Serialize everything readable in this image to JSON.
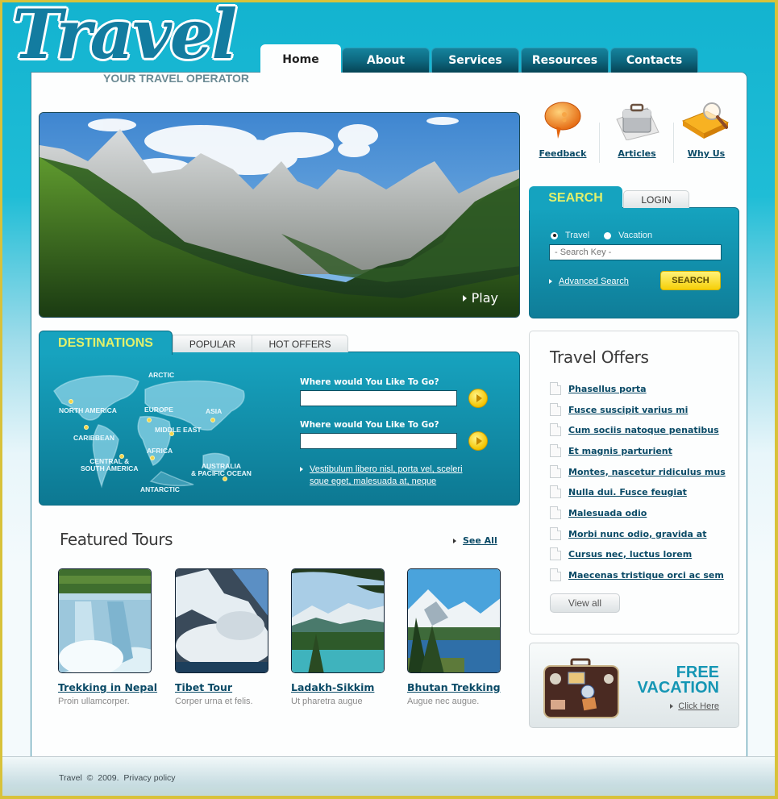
{
  "brand": {
    "logo_text": "Travel",
    "tagline": "YOUR TRAVEL OPERATOR"
  },
  "nav": {
    "items": [
      {
        "label": "Home",
        "active": true
      },
      {
        "label": "About"
      },
      {
        "label": "Services"
      },
      {
        "label": "Resources"
      },
      {
        "label": "Contacts"
      }
    ]
  },
  "hero": {
    "play_label": "Play",
    "icon": "play-triangle-icon"
  },
  "quick_links": [
    {
      "label": "Feedback",
      "icon": "speech-bubble-icon"
    },
    {
      "label": "Articles",
      "icon": "briefcase-icon"
    },
    {
      "label": "Why Us",
      "icon": "book-magnifier-icon"
    }
  ],
  "search": {
    "tabs": [
      "SEARCH",
      "LOGIN"
    ],
    "radios": [
      {
        "label": "Travel",
        "checked": true
      },
      {
        "label": "Vacation",
        "checked": false
      }
    ],
    "input_placeholder": "- Search Key -",
    "advanced_link": "Advanced Search",
    "button_label": "SEARCH"
  },
  "destinations": {
    "tabs": [
      "DESTINATIONS",
      "POPULAR",
      "HOT OFFERS"
    ],
    "map_labels": {
      "arctic": "ARCTIC",
      "north_america": "NORTH AMERICA",
      "europe": "EUROPE",
      "asia": "ASIA",
      "middle_east": "MIDDLE EAST",
      "caribbean": "CARIBBEAN",
      "africa": "AFRICA",
      "central_south_america_1": "CENTRAL &",
      "central_south_america_2": "SOUTH AMERICA",
      "australia_1": "AUSTRALIA",
      "australia_2": "& PACIFIC OCEAN",
      "antarctic": "ANTARCTIC"
    },
    "fields": [
      {
        "label": "Where would You Like To Go?",
        "value": ""
      },
      {
        "label": "Where would You Like To Go?",
        "value": ""
      }
    ],
    "link_text": "Vestibulum libero nisl, porta vel, sceleri sque eget, malesuada at, neque"
  },
  "featured": {
    "title": "Featured Tours",
    "see_all": "See All",
    "tours": [
      {
        "name": "Trekking in Nepal",
        "desc": "Proin ullamcorper."
      },
      {
        "name": "Tibet Tour",
        "desc": "Corper urna et felis."
      },
      {
        "name": "Ladakh-Sikkim",
        "desc": "Ut pharetra augue"
      },
      {
        "name": "Bhutan Trekking",
        "desc": "Augue nec augue."
      }
    ]
  },
  "offers": {
    "title": "Travel Offers",
    "items": [
      "Phasellus porta",
      "Fusce suscipit varius mi",
      "Cum sociis natoque penatibus",
      "Et magnis parturient",
      "Montes, nascetur ridiculus mus",
      "Nulla dui. Fusce feugiat",
      "Malesuada odio",
      "Morbi nunc odio, gravida at",
      "Cursus nec, luctus lorem",
      "Maecenas tristique orci ac sem"
    ],
    "view_all": "View all"
  },
  "promo": {
    "line1": "FREE",
    "line2": "VACATION",
    "link": "Click Here"
  },
  "footer": {
    "brand": "Travel",
    "copyright": "©",
    "year": "2009.",
    "privacy": "Privacy policy"
  },
  "colors": {
    "accent_teal": "#15a3bf",
    "link_dark": "#0a4a66",
    "tab_highlight": "#e2f06b",
    "button_yellow": "#f6cf08",
    "frame_border": "#d8c23a"
  }
}
